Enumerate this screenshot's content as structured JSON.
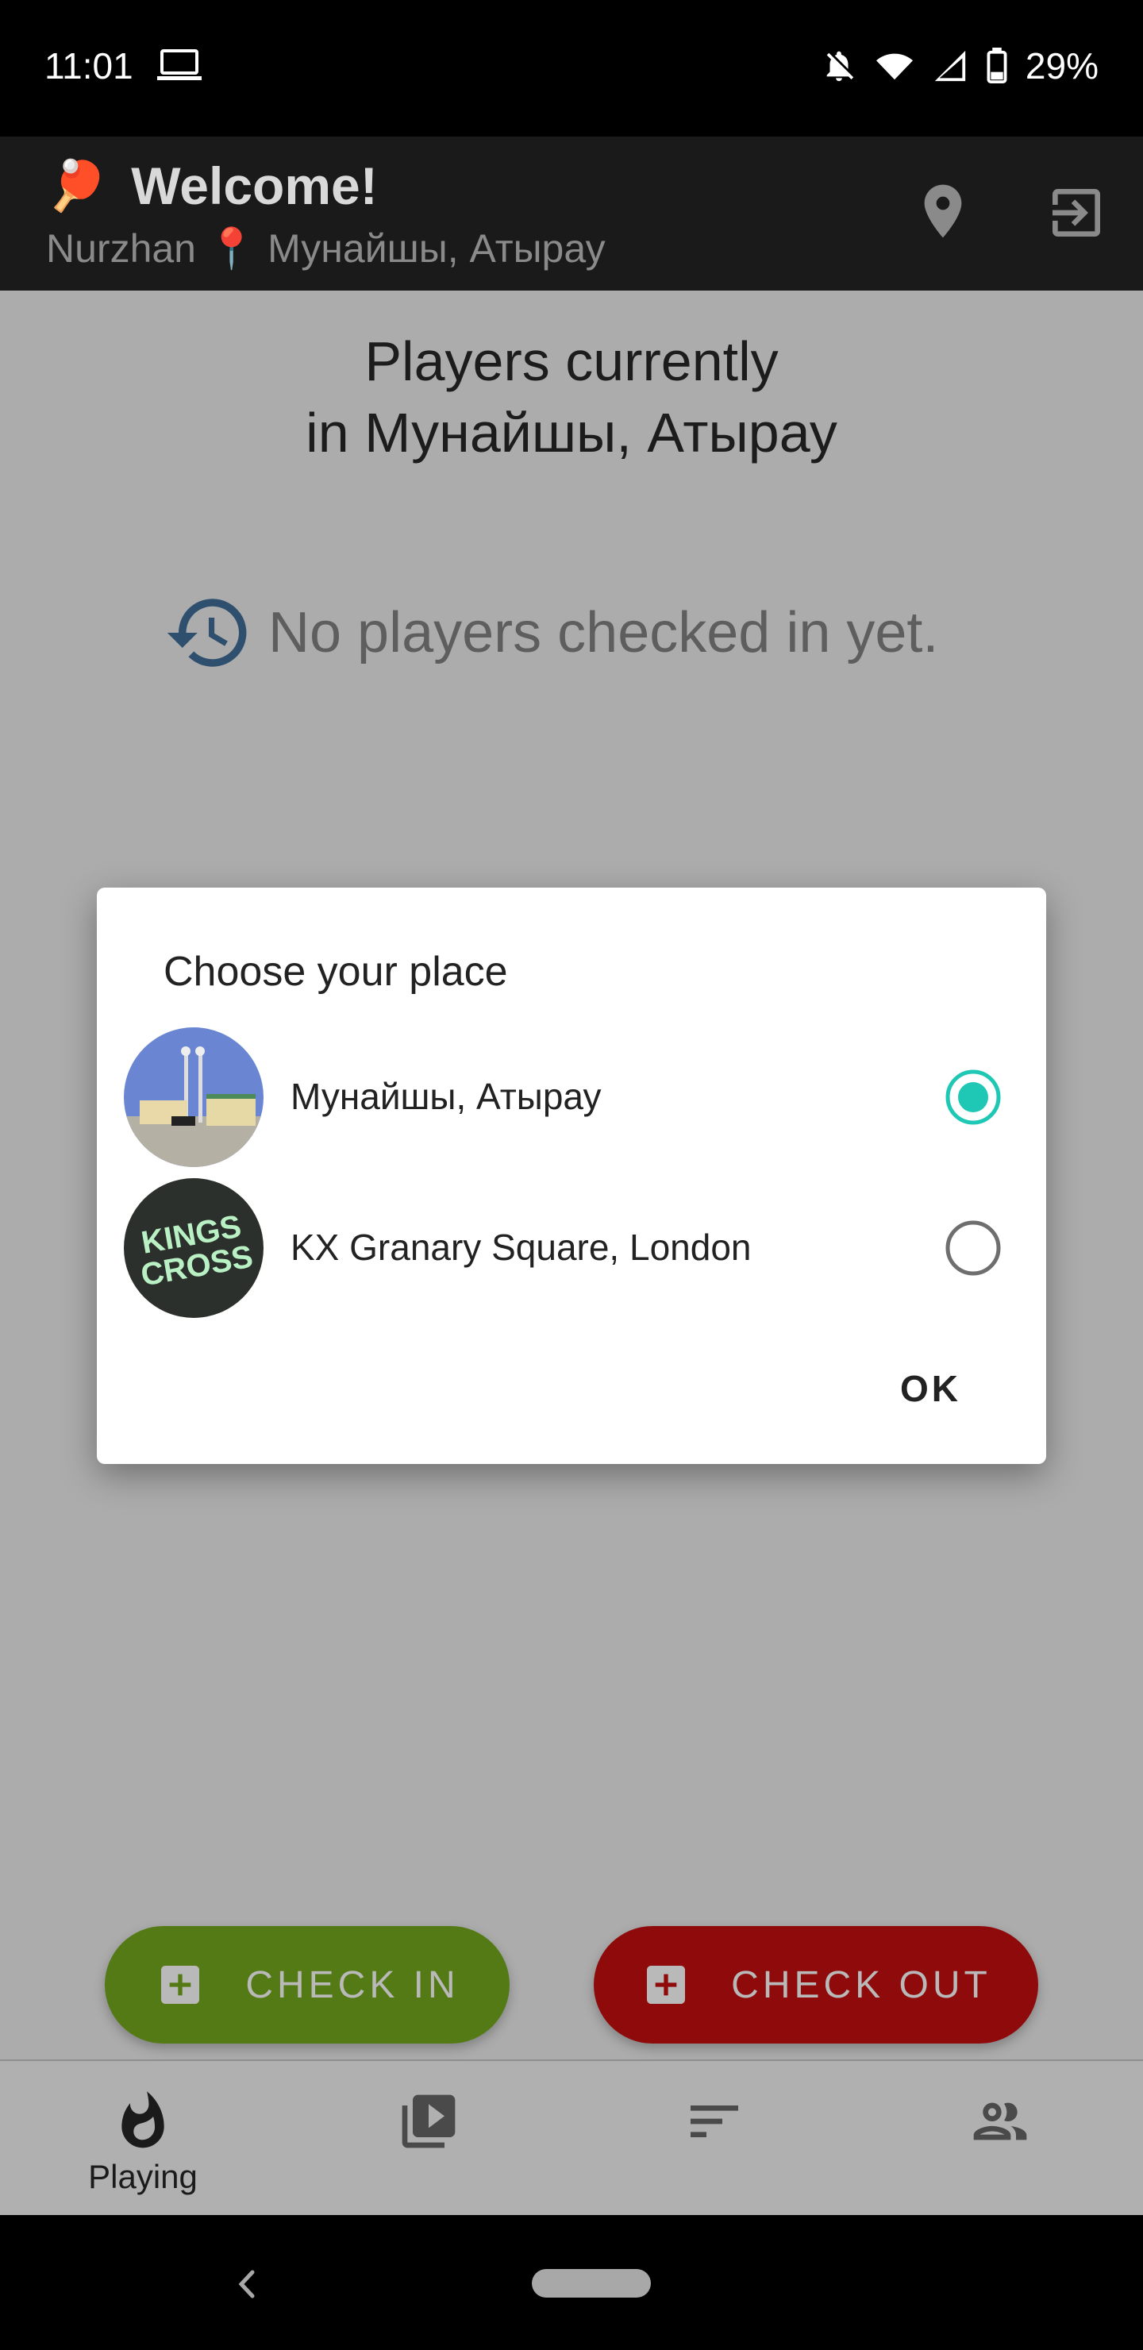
{
  "status_bar": {
    "time": "11:01",
    "battery_percent": "29%",
    "icons": [
      "laptop-icon",
      "notifications-off-icon",
      "wifi-icon",
      "signal-icon",
      "battery-icon"
    ]
  },
  "app_bar": {
    "title": "Welcome!",
    "title_emoji": "🏓",
    "user_name": "Nurzhan",
    "location_pin": "📍",
    "location": "Мунайшы, Атырау",
    "icons": [
      "location-pin-icon",
      "logout-icon"
    ]
  },
  "main": {
    "heading_line1": "Players currently",
    "heading_line2": "in Мунайшы, Атырау",
    "empty_message": "No players checked in yet."
  },
  "dialog": {
    "title": "Choose your place",
    "places": [
      {
        "name": "Мунайшы, Атырау",
        "selected": true
      },
      {
        "name": "KX Granary Square, London",
        "selected": false
      }
    ],
    "ok_label": "OK",
    "avatar_text": "KINGS CROSS"
  },
  "actions": {
    "check_in_label": "CHECK IN",
    "check_out_label": "CHECK OUT"
  },
  "bottom_nav": {
    "items": [
      {
        "label": "Playing",
        "icon": "flame-icon",
        "active": true
      },
      {
        "label": "",
        "icon": "video-library-icon",
        "active": false
      },
      {
        "label": "",
        "icon": "sort-icon",
        "active": false
      },
      {
        "label": "",
        "icon": "people-icon",
        "active": false
      }
    ]
  },
  "colors": {
    "accent_teal": "#1fc8b4",
    "check_in_green": "#537a14",
    "check_out_red": "#8f0b0b",
    "app_bar": "#1a1a1a",
    "scrim": "#acacac"
  }
}
